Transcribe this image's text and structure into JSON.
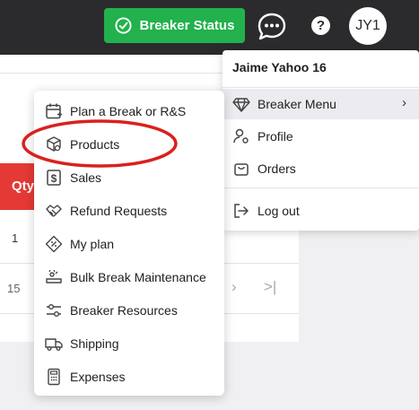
{
  "header": {
    "status_button_label": "Breaker Status",
    "avatar_initials": "JY1",
    "help_label": "?"
  },
  "background_table": {
    "qty_header": "Qty",
    "rows": [
      "1",
      "15"
    ],
    "pager_next": "›",
    "pager_last": ">|"
  },
  "user_menu": {
    "user_name": "Jaime Yahoo 16",
    "items": [
      {
        "label": "Breaker Menu",
        "icon": "diamond-icon"
      },
      {
        "label": "Profile",
        "icon": "profile-settings-icon"
      },
      {
        "label": "Orders",
        "icon": "shopping-bag-icon"
      },
      {
        "label": "Log out",
        "icon": "logout-icon"
      }
    ],
    "submenu_chevron": "›"
  },
  "breaker_menu": {
    "items": [
      {
        "label": "Plan a Break or R&S",
        "icon": "calendar-plus-icon"
      },
      {
        "label": "Products",
        "icon": "box-search-icon"
      },
      {
        "label": "Sales",
        "icon": "dollar-receipt-icon"
      },
      {
        "label": "Refund Requests",
        "icon": "handshake-icon"
      },
      {
        "label": "My plan",
        "icon": "percent-tag-icon"
      },
      {
        "label": "Bulk Break Maintenance",
        "icon": "bulk-break-icon"
      },
      {
        "label": "Breaker Resources",
        "icon": "sliders-icon"
      },
      {
        "label": "Shipping",
        "icon": "truck-icon"
      },
      {
        "label": "Expenses",
        "icon": "calculator-icon"
      }
    ]
  },
  "colors": {
    "topbar": "#2b2b2e",
    "status_green": "#22b14c",
    "qty_red": "#e53935",
    "highlight_red": "#d9211e"
  }
}
